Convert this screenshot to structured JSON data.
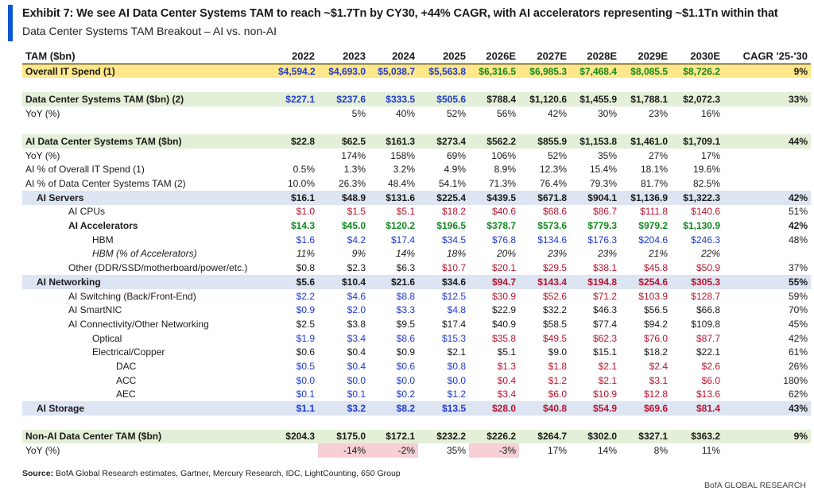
{
  "title": "Exhibit 7: We see AI Data Center Systems TAM to reach ~$1.7Tn by CY30, +44% CAGR, with AI accelerators representing ~$1.1Tn within that",
  "subtitle": "Data Center Systems TAM Breakout – AI vs. non-AI",
  "table": {
    "header": [
      "TAM ($bn)",
      "2022",
      "2023",
      "2024",
      "2025",
      "2026E",
      "2027E",
      "2028E",
      "2029E",
      "2030E",
      "CAGR '25-'30"
    ],
    "rows": [
      {
        "label": "Overall IT Spend (1)",
        "indent": 0,
        "style": "bold",
        "highlight": "yellow",
        "values": [
          "$4,594.2",
          "$4,693.0",
          "$5,038.7",
          "$5,563.8",
          "$6,316.5",
          "$6,985.3",
          "$7,468.4",
          "$8,085.5",
          "$8,726.2"
        ],
        "colors": [
          "blue",
          "blue",
          "blue",
          "blue",
          "green",
          "green",
          "green",
          "green",
          "green"
        ],
        "cagr": "9%"
      },
      {
        "spacer": true
      },
      {
        "label": "Data Center Systems TAM ($bn) (2)",
        "indent": 0,
        "style": "bold",
        "highlight": "green",
        "values": [
          "$227.1",
          "$237.6",
          "$333.5",
          "$505.6",
          "$788.4",
          "$1,120.6",
          "$1,455.9",
          "$1,788.1",
          "$2,072.3"
        ],
        "colors": [
          "blue",
          "blue",
          "blue",
          "blue",
          "black",
          "black",
          "black",
          "black",
          "black"
        ],
        "cagr": "33%"
      },
      {
        "label": "YoY (%)",
        "indent": 0,
        "style": "normal",
        "values": [
          "",
          "5%",
          "40%",
          "52%",
          "56%",
          "42%",
          "30%",
          "23%",
          "16%"
        ],
        "cagr": ""
      },
      {
        "spacer": true
      },
      {
        "label": "AI Data Center Systems TAM ($bn)",
        "indent": 0,
        "style": "bold",
        "highlight": "green",
        "values": [
          "$22.8",
          "$62.5",
          "$161.3",
          "$273.4",
          "$562.2",
          "$855.9",
          "$1,153.8",
          "$1,461.0",
          "$1,709.1"
        ],
        "cagr": "44%"
      },
      {
        "label": "YoY (%)",
        "indent": 0,
        "style": "normal",
        "values": [
          "",
          "174%",
          "158%",
          "69%",
          "106%",
          "52%",
          "35%",
          "27%",
          "17%"
        ],
        "cagr": ""
      },
      {
        "label": "AI % of Overall IT Spend (1)",
        "indent": 0,
        "style": "normal",
        "values": [
          "0.5%",
          "1.3%",
          "3.2%",
          "4.9%",
          "8.9%",
          "12.3%",
          "15.4%",
          "18.1%",
          "19.6%"
        ],
        "cagr": ""
      },
      {
        "label": "AI % of Data Center Systems TAM (2)",
        "indent": 0,
        "style": "normal",
        "values": [
          "10.0%",
          "26.3%",
          "48.4%",
          "54.1%",
          "71.3%",
          "76.4%",
          "79.3%",
          "81.7%",
          "82.5%"
        ],
        "cagr": ""
      },
      {
        "label": "AI Servers",
        "indent": 1,
        "style": "bold",
        "highlight": "blue",
        "values": [
          "$16.1",
          "$48.9",
          "$131.6",
          "$225.4",
          "$439.5",
          "$671.8",
          "$904.1",
          "$1,136.9",
          "$1,322.3"
        ],
        "cagr": "42%"
      },
      {
        "label": "AI CPUs",
        "indent": 2,
        "style": "normal",
        "values": [
          "$1.0",
          "$1.5",
          "$5.1",
          "$18.2",
          "$40.6",
          "$68.6",
          "$86.7",
          "$111.8",
          "$140.6"
        ],
        "colors": [
          "red",
          "red",
          "red",
          "red",
          "red",
          "red",
          "red",
          "red",
          "red"
        ],
        "cagr": "51%"
      },
      {
        "label": "AI Accelerators",
        "indent": 2,
        "style": "bold",
        "values": [
          "$14.3",
          "$45.0",
          "$120.2",
          "$196.5",
          "$378.7",
          "$573.6",
          "$779.3",
          "$979.2",
          "$1,130.9"
        ],
        "colors": [
          "green",
          "green",
          "green",
          "green",
          "green",
          "green",
          "green",
          "green",
          "green"
        ],
        "cagr": "42%"
      },
      {
        "label": "HBM",
        "indent": 3,
        "style": "normal",
        "values": [
          "$1.6",
          "$4.2",
          "$17.4",
          "$34.5",
          "$76.8",
          "$134.6",
          "$176.3",
          "$204.6",
          "$246.3"
        ],
        "colors": [
          "blue",
          "blue",
          "blue",
          "blue",
          "blue",
          "blue",
          "blue",
          "blue",
          "blue"
        ],
        "cagr": "48%"
      },
      {
        "label": "HBM (% of Accelerators)",
        "indent": 3,
        "style": "italic",
        "values": [
          "11%",
          "9%",
          "14%",
          "18%",
          "20%",
          "23%",
          "23%",
          "21%",
          "22%"
        ],
        "cagr": ""
      },
      {
        "label": "Other (DDR/SSD/motherboard/power/etc.)",
        "indent": 2,
        "style": "normal",
        "values": [
          "$0.8",
          "$2.3",
          "$6.3",
          "$10.7",
          "$20.1",
          "$29.5",
          "$38.1",
          "$45.8",
          "$50.9"
        ],
        "colors": [
          "black",
          "black",
          "black",
          "red",
          "red",
          "red",
          "red",
          "red",
          "red"
        ],
        "cagr": "37%"
      },
      {
        "label": "AI Networking",
        "indent": 1,
        "style": "bold",
        "highlight": "blue",
        "values": [
          "$5.6",
          "$10.4",
          "$21.6",
          "$34.6",
          "$94.7",
          "$143.4",
          "$194.8",
          "$254.6",
          "$305.3"
        ],
        "colors": [
          "black",
          "black",
          "black",
          "black",
          "red",
          "red",
          "red",
          "red",
          "red"
        ],
        "cagr": "55%"
      },
      {
        "label": "AI Switching (Back/Front-End)",
        "indent": 2,
        "style": "normal",
        "values": [
          "$2.2",
          "$4.6",
          "$8.8",
          "$12.5",
          "$30.9",
          "$52.6",
          "$71.2",
          "$103.9",
          "$128.7"
        ],
        "colors": [
          "blue",
          "blue",
          "blue",
          "blue",
          "red",
          "red",
          "red",
          "red",
          "red"
        ],
        "cagr": "59%"
      },
      {
        "label": "AI SmartNIC",
        "indent": 2,
        "style": "normal",
        "values": [
          "$0.9",
          "$2.0",
          "$3.3",
          "$4.8",
          "$22.9",
          "$32.2",
          "$46.3",
          "$56.5",
          "$66.8"
        ],
        "colors": [
          "blue",
          "blue",
          "blue",
          "blue",
          "black",
          "black",
          "black",
          "black",
          "black"
        ],
        "cagr": "70%"
      },
      {
        "label": "AI Connectivity/Other Networking",
        "indent": 2,
        "style": "normal",
        "values": [
          "$2.5",
          "$3.8",
          "$9.5",
          "$17.4",
          "$40.9",
          "$58.5",
          "$77.4",
          "$94.2",
          "$109.8"
        ],
        "cagr": "45%"
      },
      {
        "label": "Optical",
        "indent": 3,
        "style": "normal",
        "values": [
          "$1.9",
          "$3.4",
          "$8.6",
          "$15.3",
          "$35.8",
          "$49.5",
          "$62.3",
          "$76.0",
          "$87.7"
        ],
        "colors": [
          "blue",
          "blue",
          "blue",
          "blue",
          "red",
          "red",
          "red",
          "red",
          "red"
        ],
        "cagr": "42%"
      },
      {
        "label": "Electrical/Copper",
        "indent": 3,
        "style": "normal",
        "values": [
          "$0.6",
          "$0.4",
          "$0.9",
          "$2.1",
          "$5.1",
          "$9.0",
          "$15.1",
          "$18.2",
          "$22.1"
        ],
        "cagr": "61%"
      },
      {
        "label": "DAC",
        "indent": 4,
        "style": "normal",
        "values": [
          "$0.5",
          "$0.4",
          "$0.6",
          "$0.8",
          "$1.3",
          "$1.8",
          "$2.1",
          "$2.4",
          "$2.6"
        ],
        "colors": [
          "blue",
          "blue",
          "blue",
          "blue",
          "red",
          "red",
          "red",
          "red",
          "red"
        ],
        "cagr": "26%"
      },
      {
        "label": "ACC",
        "indent": 4,
        "style": "normal",
        "values": [
          "$0.0",
          "$0.0",
          "$0.0",
          "$0.0",
          "$0.4",
          "$1.2",
          "$2.1",
          "$3.1",
          "$6.0"
        ],
        "colors": [
          "blue",
          "blue",
          "blue",
          "blue",
          "red",
          "red",
          "red",
          "red",
          "red"
        ],
        "cagr": "180%"
      },
      {
        "label": "AEC",
        "indent": 4,
        "style": "normal",
        "values": [
          "$0.1",
          "$0.1",
          "$0.2",
          "$1.2",
          "$3.4",
          "$6.0",
          "$10.9",
          "$12.8",
          "$13.6"
        ],
        "colors": [
          "blue",
          "blue",
          "blue",
          "blue",
          "red",
          "red",
          "red",
          "red",
          "red"
        ],
        "cagr": "62%"
      },
      {
        "label": "AI Storage",
        "indent": 1,
        "style": "bold",
        "highlight": "blue",
        "values": [
          "$1.1",
          "$3.2",
          "$8.2",
          "$13.5",
          "$28.0",
          "$40.8",
          "$54.9",
          "$69.6",
          "$81.4"
        ],
        "colors": [
          "blue",
          "blue",
          "blue",
          "blue",
          "red",
          "red",
          "red",
          "red",
          "red"
        ],
        "cagr": "43%"
      },
      {
        "spacer": true
      },
      {
        "label": "Non-AI Data Center TAM ($bn)",
        "indent": 0,
        "style": "bold",
        "highlight": "green",
        "values": [
          "$204.3",
          "$175.0",
          "$172.1",
          "$232.2",
          "$226.2",
          "$264.7",
          "$302.0",
          "$327.1",
          "$363.2"
        ],
        "cagr": "9%"
      },
      {
        "label": "YoY (%)",
        "indent": 0,
        "style": "normal",
        "values": [
          "",
          "-14%",
          "-2%",
          "35%",
          "-3%",
          "17%",
          "14%",
          "8%",
          "11%"
        ],
        "negative": [
          false,
          true,
          true,
          false,
          true,
          false,
          false,
          false,
          false
        ],
        "cagr": ""
      }
    ]
  },
  "source_label": "Source:",
  "source_text": " BofA Global Research estimates, Gartner, Mercury Research, IDC, LightCounting, 650 Group",
  "brand": "BofA GLOBAL RESEARCH",
  "colors": {
    "accent": "#0b57d0",
    "yellow_highlight": "#ffe78a",
    "green_highlight": "#e3efd7",
    "blue_highlight": "#dde4f2",
    "negative_fill": "#f6d0d5",
    "blue_text": "#1f3ad1",
    "red_text": "#b8142f",
    "green_text": "#0f8a1d"
  }
}
